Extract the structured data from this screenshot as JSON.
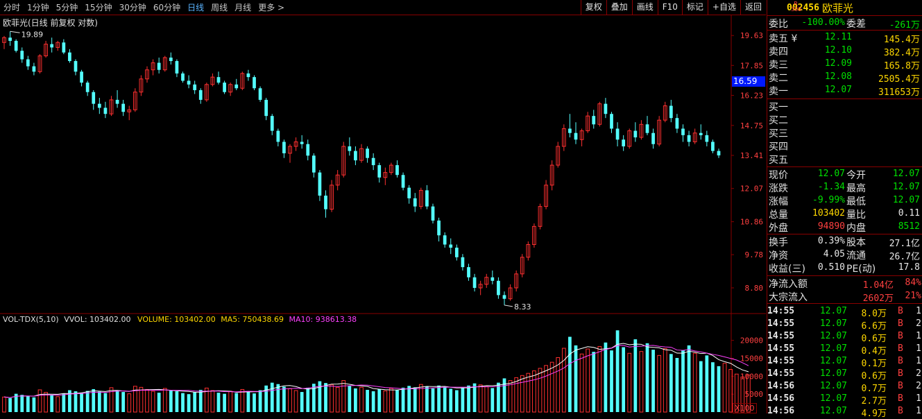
{
  "toolbar": {
    "periods": [
      "分时",
      "1分钟",
      "5分钟",
      "15分钟",
      "30分钟",
      "60分钟",
      "日线",
      "周线",
      "月线",
      "更多 >"
    ],
    "active_period": "日线",
    "buttons": [
      "复权",
      "叠加",
      "画线",
      "F10",
      "标记",
      "+自选",
      "返回"
    ]
  },
  "chart": {
    "title": "欧菲光(日线 前复权 对数)",
    "high_label": "19.89",
    "low_label": "8.33",
    "current_price_tag": "16.59",
    "price_ticks": [
      "19.63",
      "17.85",
      "16.23",
      "14.75",
      "13.41",
      "12.07",
      "10.86",
      "9.78",
      "8.80"
    ],
    "volume_header": {
      "name": "VOL-TDX(5,10)",
      "vvol": "VVOL: 103402.00",
      "volume": "VOLUME: 103402.00",
      "ma5": "MA5: 750438.69",
      "ma10": "MA10: 938613.38"
    },
    "volume_ticks": [
      "20000",
      "15000",
      "10000",
      "5000"
    ],
    "volume_unit": "X100",
    "colors": {
      "up": "#ff3030",
      "down": "#54ffff",
      "ma5": "#ffffff",
      "ma10": "#ff40ff",
      "grid": "#8a0000",
      "axis_text": "#ff4040"
    }
  },
  "chart_data": {
    "type": "candlestick",
    "yscale": "log",
    "ylim": [
      8.2,
      20.3
    ],
    "ohlc": [
      [
        19.2,
        19.6,
        18.8,
        19.5
      ],
      [
        19.5,
        19.89,
        19.0,
        19.3
      ],
      [
        19.3,
        19.4,
        18.6,
        18.7
      ],
      [
        18.7,
        18.9,
        18.0,
        18.2
      ],
      [
        18.2,
        18.4,
        17.6,
        17.8
      ],
      [
        17.8,
        18.0,
        17.3,
        17.5
      ],
      [
        17.5,
        18.5,
        17.4,
        18.4
      ],
      [
        18.4,
        19.3,
        18.3,
        19.1
      ],
      [
        19.1,
        19.5,
        18.6,
        18.9
      ],
      [
        18.9,
        19.3,
        18.7,
        19.2
      ],
      [
        19.2,
        19.4,
        18.5,
        18.6
      ],
      [
        18.6,
        18.8,
        18.0,
        18.1
      ],
      [
        18.1,
        18.2,
        17.3,
        17.5
      ],
      [
        17.5,
        17.6,
        16.7,
        16.9
      ],
      [
        16.9,
        17.0,
        16.2,
        16.4
      ],
      [
        16.4,
        16.5,
        15.5,
        15.8
      ],
      [
        15.8,
        16.1,
        15.3,
        15.6
      ],
      [
        15.6,
        15.9,
        15.1,
        15.3
      ],
      [
        15.3,
        16.2,
        15.2,
        16.0
      ],
      [
        16.0,
        16.5,
        15.6,
        15.8
      ],
      [
        15.8,
        16.0,
        15.2,
        15.4
      ],
      [
        15.4,
        15.7,
        15.0,
        15.5
      ],
      [
        15.5,
        16.6,
        15.4,
        16.4
      ],
      [
        16.4,
        17.3,
        16.2,
        17.1
      ],
      [
        17.1,
        17.8,
        16.9,
        17.6
      ],
      [
        17.6,
        18.2,
        17.3,
        18.0
      ],
      [
        18.0,
        18.3,
        17.4,
        17.6
      ],
      [
        17.6,
        18.4,
        17.5,
        18.3
      ],
      [
        18.3,
        18.6,
        17.9,
        18.1
      ],
      [
        18.1,
        18.2,
        17.2,
        17.4
      ],
      [
        17.4,
        17.5,
        16.9,
        17.0
      ],
      [
        17.0,
        17.3,
        16.6,
        16.8
      ],
      [
        16.8,
        17.0,
        16.3,
        16.5
      ],
      [
        16.5,
        16.6,
        15.8,
        16.0
      ],
      [
        16.0,
        16.9,
        15.9,
        16.8
      ],
      [
        16.8,
        17.4,
        16.7,
        17.2
      ],
      [
        17.2,
        17.5,
        16.8,
        16.9
      ],
      [
        16.9,
        17.0,
        16.3,
        16.4
      ],
      [
        16.4,
        16.9,
        16.2,
        16.8
      ],
      [
        16.8,
        17.1,
        16.5,
        16.6
      ],
      [
        16.6,
        17.5,
        16.5,
        17.4
      ],
      [
        17.4,
        17.6,
        17.0,
        17.2
      ],
      [
        17.2,
        17.3,
        16.5,
        16.6
      ],
      [
        16.6,
        16.7,
        15.9,
        16.0
      ],
      [
        16.0,
        16.1,
        15.0,
        15.2
      ],
      [
        15.2,
        15.3,
        14.3,
        14.5
      ],
      [
        14.5,
        14.6,
        13.8,
        14.0
      ],
      [
        14.0,
        14.1,
        13.3,
        13.5
      ],
      [
        13.5,
        13.9,
        13.1,
        13.8
      ],
      [
        13.8,
        14.2,
        13.6,
        14.0
      ],
      [
        14.0,
        14.3,
        13.7,
        13.9
      ],
      [
        13.9,
        14.1,
        13.2,
        13.4
      ],
      [
        13.4,
        13.5,
        12.5,
        12.7
      ],
      [
        12.7,
        12.8,
        11.6,
        11.8
      ],
      [
        11.8,
        12.0,
        11.0,
        11.3
      ],
      [
        11.3,
        12.4,
        11.2,
        12.2
      ],
      [
        12.2,
        12.8,
        12.0,
        12.6
      ],
      [
        12.6,
        14.0,
        12.5,
        13.8
      ],
      [
        13.8,
        14.2,
        13.4,
        13.6
      ],
      [
        13.6,
        13.8,
        13.0,
        13.2
      ],
      [
        13.2,
        13.9,
        13.1,
        13.7
      ],
      [
        13.7,
        13.8,
        13.1,
        13.3
      ],
      [
        13.3,
        13.5,
        12.8,
        13.0
      ],
      [
        13.0,
        13.1,
        12.3,
        12.5
      ],
      [
        12.5,
        12.9,
        12.2,
        12.7
      ],
      [
        12.7,
        13.1,
        12.6,
        13.0
      ],
      [
        13.0,
        13.2,
        12.5,
        12.6
      ],
      [
        12.6,
        12.7,
        12.0,
        12.1
      ],
      [
        12.1,
        12.2,
        11.5,
        11.7
      ],
      [
        11.7,
        11.9,
        11.2,
        11.4
      ],
      [
        11.4,
        12.1,
        11.3,
        12.0
      ],
      [
        12.0,
        12.2,
        11.3,
        11.4
      ],
      [
        11.4,
        11.5,
        10.8,
        10.9
      ],
      [
        10.9,
        11.0,
        10.2,
        10.4
      ],
      [
        10.4,
        10.5,
        10.0,
        10.1
      ],
      [
        10.1,
        10.3,
        9.8,
        10.0
      ],
      [
        10.0,
        10.1,
        9.6,
        9.7
      ],
      [
        9.7,
        9.8,
        9.3,
        9.4
      ],
      [
        9.4,
        9.5,
        9.0,
        9.1
      ],
      [
        9.1,
        9.2,
        8.7,
        8.8
      ],
      [
        8.8,
        9.0,
        8.6,
        8.9
      ],
      [
        8.9,
        9.2,
        8.8,
        9.1
      ],
      [
        9.1,
        9.3,
        8.9,
        9.0
      ],
      [
        9.0,
        9.1,
        8.5,
        8.6
      ],
      [
        8.6,
        8.7,
        8.33,
        8.5
      ],
      [
        8.5,
        8.9,
        8.45,
        8.8
      ],
      [
        8.8,
        9.3,
        8.7,
        9.2
      ],
      [
        9.2,
        9.8,
        9.1,
        9.7
      ],
      [
        9.7,
        10.2,
        9.6,
        10.1
      ],
      [
        10.1,
        10.8,
        10.0,
        10.7
      ],
      [
        10.7,
        11.5,
        10.6,
        11.4
      ],
      [
        11.4,
        12.4,
        11.3,
        12.2
      ],
      [
        12.2,
        13.2,
        12.0,
        13.0
      ],
      [
        13.0,
        14.0,
        12.9,
        13.8
      ],
      [
        13.8,
        14.8,
        13.6,
        14.6
      ],
      [
        14.6,
        15.3,
        14.2,
        14.4
      ],
      [
        14.4,
        14.9,
        13.9,
        14.1
      ],
      [
        14.1,
        14.6,
        13.8,
        14.5
      ],
      [
        14.5,
        15.4,
        14.4,
        15.2
      ],
      [
        15.2,
        15.5,
        14.6,
        14.8
      ],
      [
        14.8,
        15.9,
        14.7,
        15.8
      ],
      [
        15.8,
        16.1,
        15.1,
        15.3
      ],
      [
        15.3,
        15.4,
        14.4,
        14.6
      ],
      [
        14.6,
        14.9,
        13.8,
        14.1
      ],
      [
        14.1,
        14.3,
        13.6,
        13.8
      ],
      [
        13.8,
        14.6,
        13.7,
        14.5
      ],
      [
        14.5,
        14.9,
        14.0,
        14.2
      ],
      [
        14.2,
        15.0,
        14.1,
        14.8
      ],
      [
        14.8,
        15.2,
        14.3,
        14.4
      ],
      [
        14.4,
        14.6,
        13.7,
        13.9
      ],
      [
        13.9,
        15.2,
        13.8,
        15.0
      ],
      [
        15.0,
        15.9,
        14.9,
        15.7
      ],
      [
        15.7,
        16.0,
        14.9,
        15.1
      ],
      [
        15.1,
        15.3,
        14.4,
        14.6
      ],
      [
        14.6,
        14.8,
        14.0,
        14.3
      ],
      [
        14.3,
        14.5,
        13.8,
        14.0
      ],
      [
        14.0,
        14.6,
        13.9,
        14.4
      ],
      [
        14.4,
        14.8,
        14.1,
        14.3
      ],
      [
        14.3,
        14.5,
        13.8,
        14.0
      ],
      [
        14.0,
        14.1,
        13.5,
        13.6
      ],
      [
        13.6,
        13.7,
        13.3,
        13.41
      ]
    ],
    "volume": [
      4200,
      3900,
      5100,
      4800,
      4400,
      4100,
      6200,
      5500,
      4700,
      4300,
      5200,
      6100,
      5800,
      5400,
      5900,
      6400,
      5700,
      5300,
      6800,
      6000,
      5600,
      5100,
      7200,
      6900,
      6300,
      5800,
      5400,
      6600,
      6100,
      5800,
      5300,
      5000,
      5500,
      6200,
      6700,
      6000,
      5400,
      5100,
      5800,
      5300,
      6300,
      5700,
      5200,
      6100,
      7400,
      8200,
      7800,
      7100,
      6500,
      6000,
      5600,
      6800,
      7900,
      8600,
      8100,
      7600,
      6900,
      8800,
      7300,
      6600,
      6900,
      6200,
      5800,
      6400,
      5900,
      6600,
      6100,
      6800,
      7300,
      6900,
      7700,
      7100,
      6600,
      7400,
      7000,
      6500,
      6100,
      6800,
      7400,
      8000,
      7600,
      7100,
      6700,
      8200,
      9400,
      8800,
      9600,
      10200,
      10800,
      11500,
      12200,
      13000,
      13900,
      15200,
      17800,
      21000,
      18600,
      16200,
      17600,
      16800,
      18300,
      19400,
      17200,
      22800,
      18100,
      16400,
      20300,
      16900,
      19200,
      17400,
      15800,
      17700,
      16200,
      15100,
      17300,
      18600,
      16400,
      14200,
      15800,
      13900,
      12800,
      13600,
      11900,
      10600,
      9800,
      10340
    ],
    "ma5_vol_shape": "line",
    "title": "欧菲光(日线 前复权 对数)"
  },
  "quote": {
    "code": "002456",
    "name": "欧菲光",
    "mark": "R 300",
    "webi": {
      "label": "委比",
      "value": "-100.00%",
      "label2": "委差",
      "value2": "-261万"
    },
    "asks": [
      {
        "label": "卖五 ¥",
        "price": "12.11",
        "vol": "145.4万"
      },
      {
        "label": "卖四",
        "price": "12.10",
        "vol": "382.4万"
      },
      {
        "label": "卖三",
        "price": "12.09",
        "vol": "165.8万"
      },
      {
        "label": "卖二",
        "price": "12.08",
        "vol": "2505.4万"
      },
      {
        "label": "卖一",
        "price": "12.07",
        "vol": "311653万"
      }
    ],
    "bids": [
      "买一",
      "买二",
      "买三",
      "买四",
      "买五"
    ],
    "stats": [
      {
        "l1": "现价",
        "v1": "12.07",
        "c1": "green",
        "l2": "今开",
        "v2": "12.07",
        "c2": "green"
      },
      {
        "l1": "涨跌",
        "v1": "-1.34",
        "c1": "green",
        "l2": "最高",
        "v2": "12.07",
        "c2": "green"
      },
      {
        "l1": "涨幅",
        "v1": "-9.99%",
        "c1": "green",
        "l2": "最低",
        "v2": "12.07",
        "c2": "green"
      },
      {
        "l1": "总量",
        "v1": "103402",
        "c1": "yellow",
        "l2": "量比",
        "v2": "0.11",
        "c2": "white"
      },
      {
        "l1": "外盘",
        "v1": "94890",
        "c1": "red",
        "l2": "内盘",
        "v2": "8512",
        "c2": "green"
      }
    ],
    "stats2": [
      {
        "l1": "换手",
        "v1": "0.39%",
        "l2": "股本",
        "v2": "27.1亿"
      },
      {
        "l1": "净资",
        "v1": "4.05",
        "l2": "流通",
        "v2": "26.7亿"
      },
      {
        "l1": "收益(三)",
        "v1": "0.510",
        "l2": "PE(动)",
        "v2": "17.8"
      }
    ],
    "flow": [
      {
        "label": "净流入额",
        "v1": "1.04亿",
        "v2": "84%"
      },
      {
        "label": "大宗流入",
        "v1": "2602万",
        "v2": "21%"
      }
    ],
    "ticks": [
      {
        "time": "14:55",
        "price": "12.07",
        "vol": "8.0万",
        "side": "B",
        "n": "1"
      },
      {
        "time": "14:55",
        "price": "12.07",
        "vol": "6.6万",
        "side": "B",
        "n": "2"
      },
      {
        "time": "14:55",
        "price": "12.07",
        "vol": "0.6万",
        "side": "B",
        "n": "1"
      },
      {
        "time": "14:55",
        "price": "12.07",
        "vol": "0.4万",
        "side": "B",
        "n": "1"
      },
      {
        "time": "14:55",
        "price": "12.07",
        "vol": "0.1万",
        "side": "B",
        "n": "1"
      },
      {
        "time": "14:55",
        "price": "12.07",
        "vol": "0.6万",
        "side": "B",
        "n": "2"
      },
      {
        "time": "14:56",
        "price": "12.07",
        "vol": "0.7万",
        "side": "B",
        "n": "2"
      },
      {
        "time": "14:56",
        "price": "12.07",
        "vol": "2.7万",
        "side": "B",
        "n": "1"
      },
      {
        "time": "14:56",
        "price": "12.07",
        "vol": "4.9万",
        "side": "B",
        "n": "1"
      }
    ]
  }
}
